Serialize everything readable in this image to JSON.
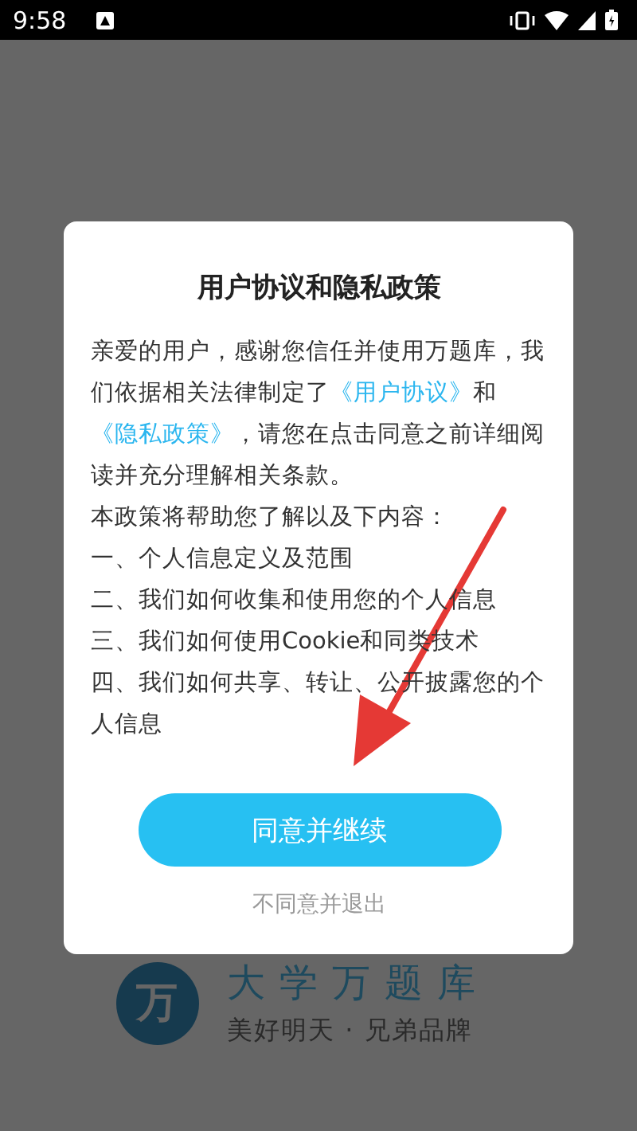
{
  "status_bar": {
    "time": "9:58"
  },
  "dialog": {
    "title": "用户协议和隐私政策",
    "intro": [
      {
        "kind": "text",
        "text": "亲爱的用户，感谢您信任并使用万题库，我们依据相关法律制定了"
      },
      {
        "kind": "link",
        "text": "《用户协议》"
      },
      {
        "kind": "text",
        "text": "和"
      },
      {
        "kind": "link",
        "text": "《隐私政策》"
      },
      {
        "kind": "text",
        "text": "，请您在点击同意之前详细阅读并充分理解相关条款。"
      }
    ],
    "lines": [
      "本政策将帮助您了解以及下内容：",
      "一、个人信息定义及范围",
      "二、我们如何收集和使用您的个人信息",
      "三、我们如何使用Cookie和同类技术",
      "四、我们如何共享、转让、公开披露您的个人信息"
    ],
    "agree_button": "同意并继续",
    "decline_link": "不同意并退出"
  },
  "brand": {
    "logo_mark": "万",
    "name": "大学万题库",
    "slogan": "美好明天 · 兄弟品牌"
  }
}
